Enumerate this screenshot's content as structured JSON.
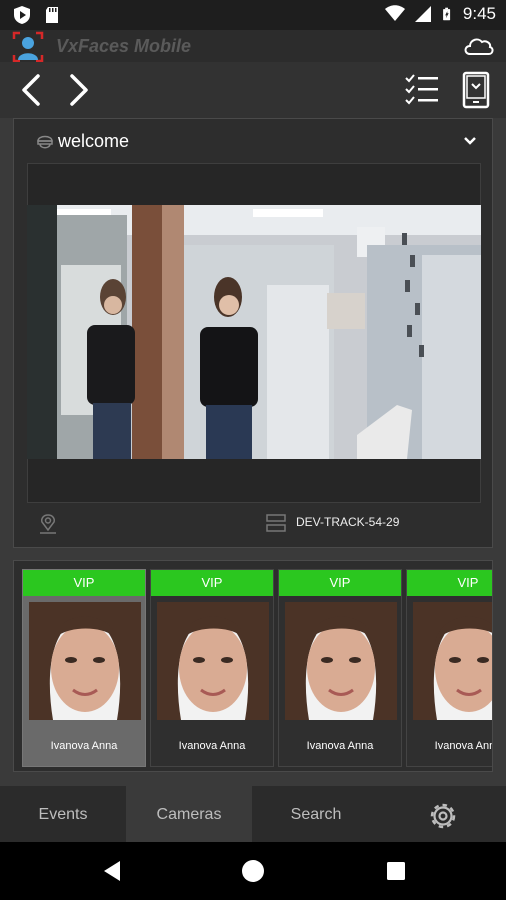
{
  "status_bar": {
    "time": "9:45"
  },
  "app": {
    "title": "VxFaces Mobile"
  },
  "camera": {
    "name": "welcome",
    "device": "DEV-TRACK-54-29"
  },
  "events": [
    {
      "badge": "VIP",
      "name": "Ivanova Anna",
      "selected": true
    },
    {
      "badge": "VIP",
      "name": "Ivanova Anna",
      "selected": false
    },
    {
      "badge": "VIP",
      "name": "Ivanova Anna",
      "selected": false
    },
    {
      "badge": "VIP",
      "name": "Ivanova Anna",
      "selected": false
    }
  ],
  "tabs": [
    {
      "label": "Events",
      "active": false
    },
    {
      "label": "Cameras",
      "active": true
    },
    {
      "label": "Search",
      "active": false
    }
  ],
  "colors": {
    "vip_badge": "#2bc71f",
    "background": "#3a3a3a",
    "accent_logo": "#d62828"
  },
  "icons": [
    "shield-icon",
    "sd-card-icon",
    "wifi-icon",
    "signal-icon",
    "battery-icon",
    "face-logo-icon",
    "cloud-icon",
    "back-arrow-icon",
    "forward-arrow-icon",
    "checklist-icon",
    "tablet-icon",
    "camera-dome-icon",
    "chevron-down-icon",
    "location-pin-icon",
    "server-icon",
    "gear-icon"
  ]
}
